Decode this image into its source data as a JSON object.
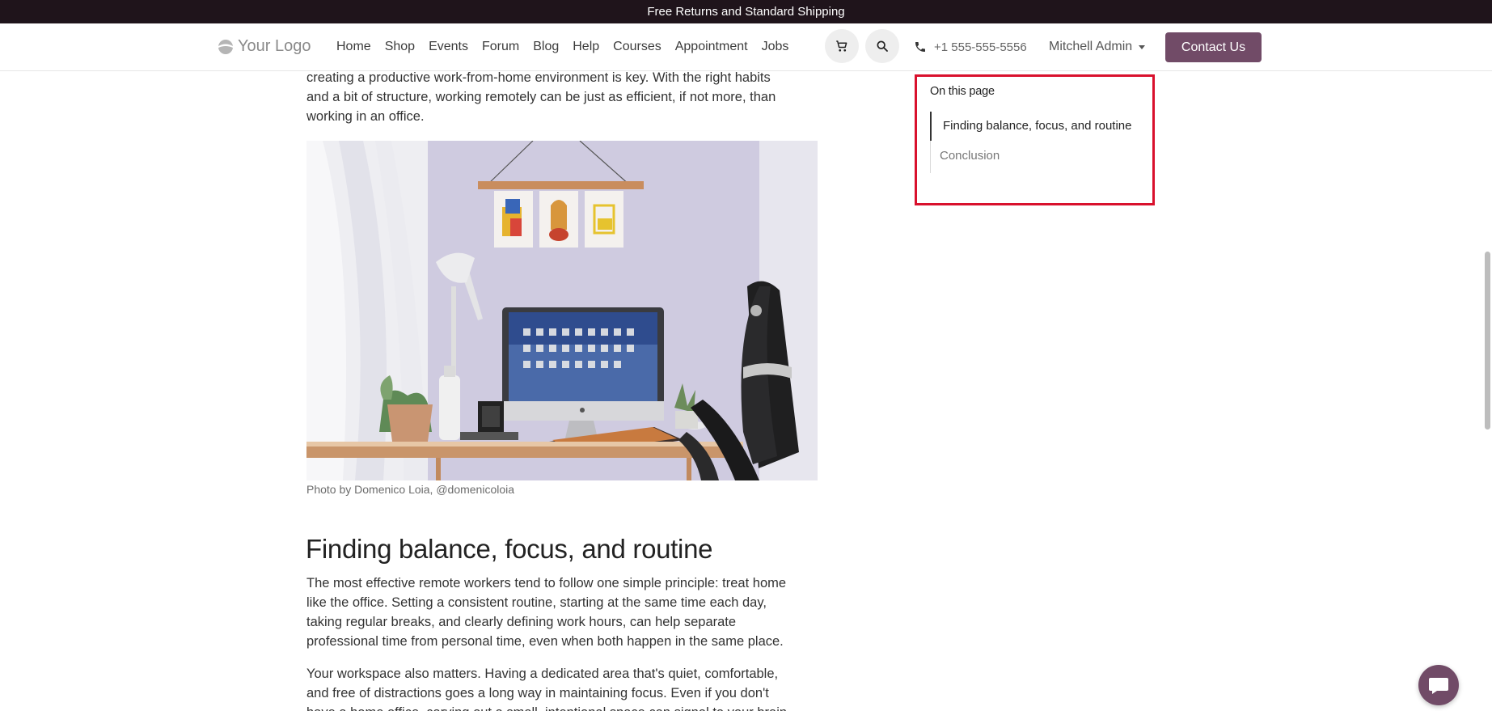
{
  "announcement": "Free Returns and Standard Shipping",
  "header": {
    "logo_text": "Your Logo",
    "menu": [
      "Home",
      "Shop",
      "Events",
      "Forum",
      "Blog",
      "Help",
      "Courses",
      "Appointment",
      "Jobs"
    ],
    "phone": "+1 555-555-5556",
    "user": "Mitchell Admin",
    "contact_label": "Contact Us"
  },
  "article": {
    "intro_lines": [
      "creating a productive work-from-home environment is key. With the right habits",
      "and a bit of structure, working remotely can be just as efficient, if not more, than",
      "working in an office."
    ],
    "photo_caption": "Photo by Domenico Loia, @domenicoloia",
    "section_heading": "Finding balance, focus, and routine",
    "para1_lines": [
      "The most effective remote workers tend to follow one simple principle: treat home",
      "like the office. Setting a consistent routine, starting at the same time each day,",
      "taking regular breaks, and clearly defining work hours, can help separate",
      "professional time from personal time, even when both happen in the same place."
    ],
    "para2_lines": [
      "Your workspace also matters. Having a dedicated area that's quiet, comfortable,",
      "and free of distractions goes a long way in maintaining focus. Even if you don't",
      "have a home office, carving out a small, intentional space can signal to your brain"
    ]
  },
  "toc": {
    "title": "On this page",
    "items": [
      "Finding balance, focus, and routine",
      "Conclusion"
    ]
  },
  "colors": {
    "brand": "#714b67",
    "topbar": "#1f141b",
    "highlight": "#d9112d"
  }
}
